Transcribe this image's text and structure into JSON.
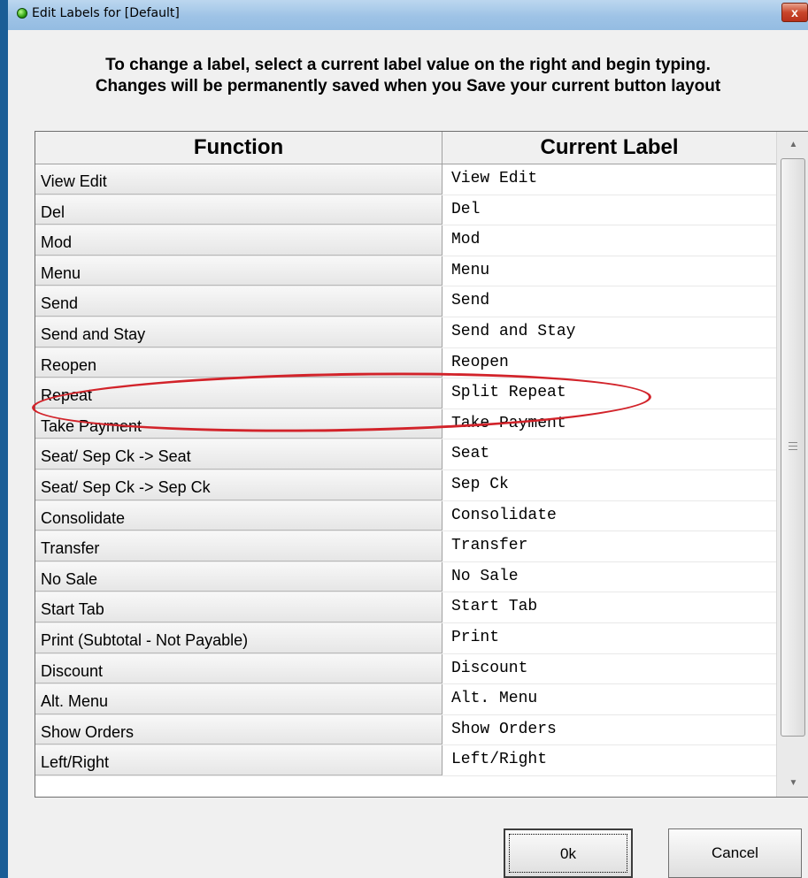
{
  "window": {
    "title": "Edit Labels for [Default]",
    "close_label": "x"
  },
  "instructions": {
    "line1": "To change a label, select a current label value on the right and begin typing.",
    "line2": "Changes will be permanently saved when you Save your current button layout"
  },
  "table": {
    "headers": {
      "function": "Function",
      "current_label": "Current Label"
    },
    "rows": [
      {
        "function": "View Edit",
        "label": "View Edit"
      },
      {
        "function": "Del",
        "label": "Del"
      },
      {
        "function": "Mod",
        "label": "Mod"
      },
      {
        "function": "Menu",
        "label": "Menu"
      },
      {
        "function": "Send",
        "label": "Send"
      },
      {
        "function": "Send and Stay",
        "label": "Send and Stay"
      },
      {
        "function": "Reopen",
        "label": "Reopen"
      },
      {
        "function": "Repeat",
        "label": "Split Repeat"
      },
      {
        "function": "Take Payment",
        "label": "Take Payment"
      },
      {
        "function": "Seat/ Sep Ck -> Seat",
        "label": "Seat"
      },
      {
        "function": "Seat/ Sep Ck -> Sep Ck",
        "label": "Sep Ck"
      },
      {
        "function": "Consolidate",
        "label": "Consolidate"
      },
      {
        "function": "Transfer",
        "label": "Transfer"
      },
      {
        "function": "No Sale",
        "label": "No Sale"
      },
      {
        "function": "Start Tab",
        "label": "Start Tab"
      },
      {
        "function": "Print (Subtotal - Not Payable)",
        "label": "Print"
      },
      {
        "function": "Discount",
        "label": "Discount"
      },
      {
        "function": "Alt. Menu",
        "label": "Alt. Menu"
      },
      {
        "function": "Show Orders",
        "label": "Show Orders"
      },
      {
        "function": "Left/Right",
        "label": "Left/Right"
      }
    ]
  },
  "buttons": {
    "ok": "0k",
    "cancel": "Cancel"
  },
  "colors": {
    "highlight": "#d2232a",
    "titlebar": "#9ec3e6"
  }
}
